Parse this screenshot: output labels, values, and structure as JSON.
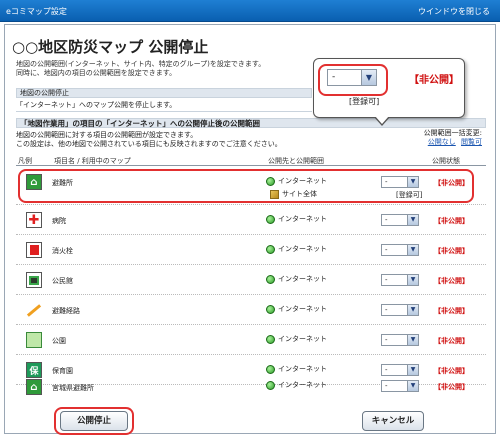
{
  "window": {
    "title": "eコミマップ設定",
    "close_label": "ウインドウを閉じる"
  },
  "page_title": "○○地区防災マップ 公開停止",
  "intro": [
    "地図の公開範囲(インターネット、サイト内、特定のグループ)を設定できます。",
    "同時に、地図内の項目の公開範囲を設定できます。"
  ],
  "map_public": {
    "heading": "地図の公開停止",
    "text": "「インターネット」へのマップ公開を停止します。"
  },
  "section2": {
    "heading": "「地図作業用」の項目の「インターネット」への公開停止後の公開範囲",
    "desc": [
      "地図の公開範囲に対する項目の公開範囲が設定できます。",
      "この設定は、他の地図で公開されている項目にも反映されますのでご注意ください。"
    ],
    "bulk_label": "公開範囲一括変更:",
    "bulk_links": [
      "公開なし",
      "閲覧可"
    ]
  },
  "columns": {
    "legend": "凡例",
    "item": "項目名 / 利用中のマップ",
    "scope": "公開先と公開範囲",
    "state": "公開状態"
  },
  "callout": {
    "select_value": "-",
    "state": "【非公開】",
    "note": "[登録可]"
  },
  "rows": [
    {
      "name": "避難所",
      "scope": "インターネット",
      "scope2": "サイト全体",
      "select": "-",
      "state": "【非公開】",
      "reg": "[登録可]"
    },
    {
      "name": "病院",
      "scope": "インターネット",
      "select": "-",
      "state": "【非公開】"
    },
    {
      "name": "消火栓",
      "scope": "インターネット",
      "select": "-",
      "state": "【非公開】"
    },
    {
      "name": "公民館",
      "scope": "インターネット",
      "select": "-",
      "state": "【非公開】"
    },
    {
      "name": "避難経路",
      "scope": "インターネット",
      "select": "-",
      "state": "【非公開】"
    },
    {
      "name": "公園",
      "scope": "インターネット",
      "select": "-",
      "state": "【非公開】"
    },
    {
      "name": "保育園",
      "scope": "インターネット",
      "select": "-",
      "state": "【非公開】"
    },
    {
      "name": "宮城県避難所",
      "scope": "インターネット",
      "select": "-",
      "state": "【非公開】"
    }
  ],
  "buttons": {
    "stop": "公開停止",
    "cancel": "キャンセル"
  }
}
